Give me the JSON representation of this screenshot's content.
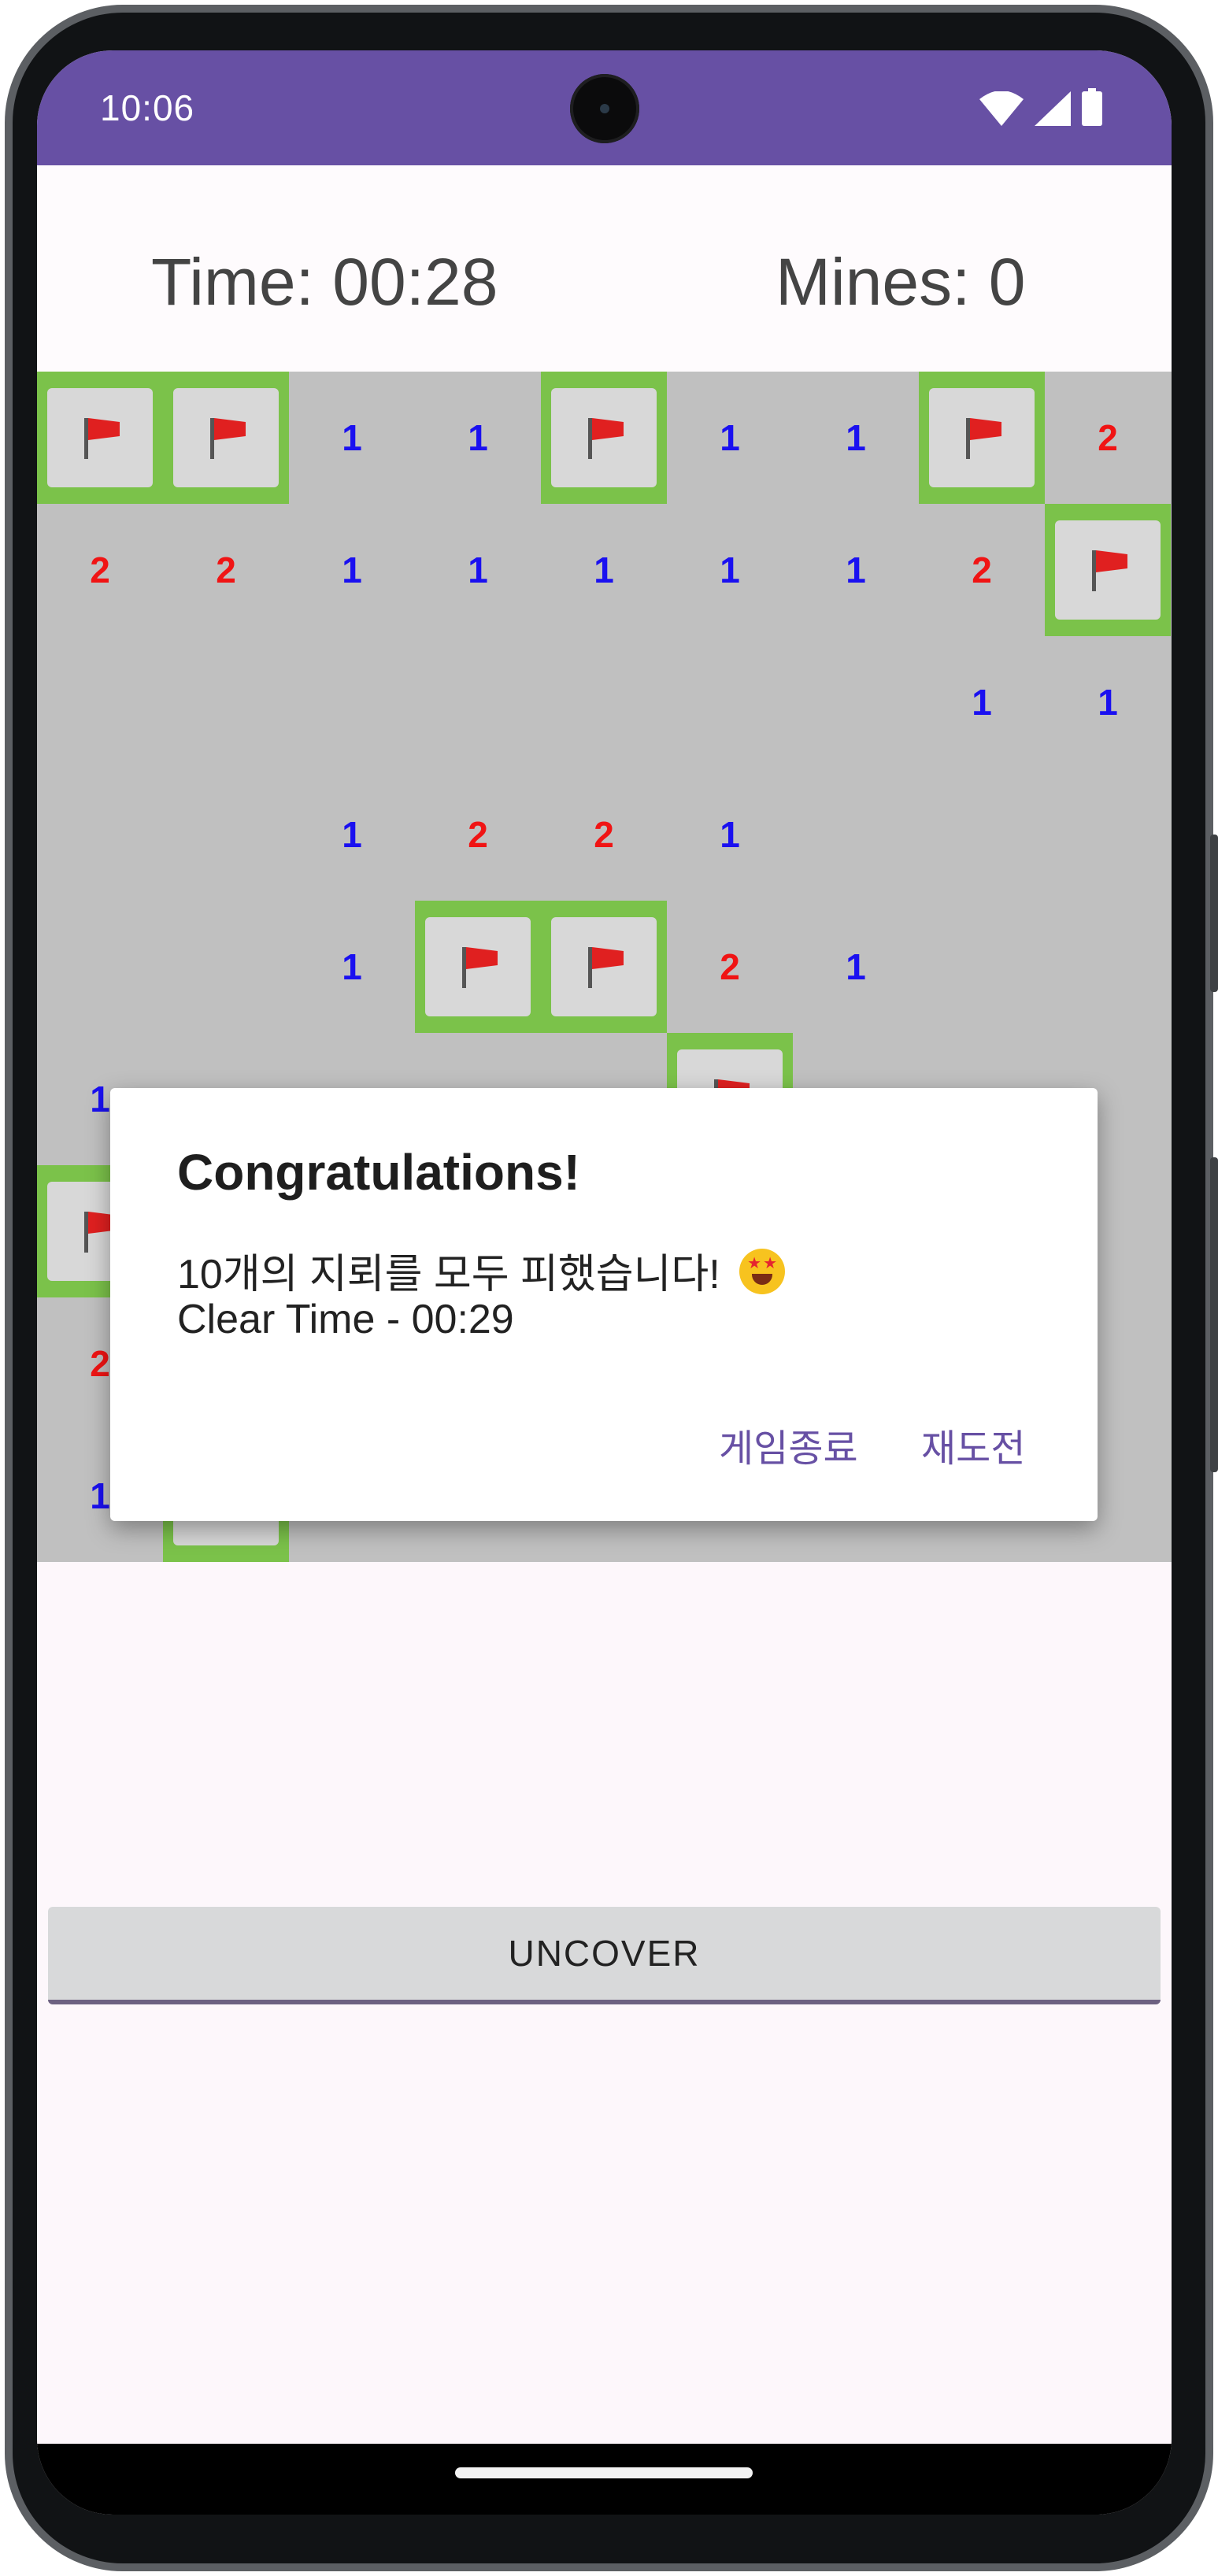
{
  "status_bar": {
    "time": "10:06",
    "icons": [
      "wifi-icon",
      "cellular-signal-icon",
      "battery-icon"
    ],
    "color": "#6750a4"
  },
  "header": {
    "time_label": "Time: 00:28",
    "mines_label": "Mines: 0"
  },
  "board": {
    "columns": 9,
    "visible_rows": [
      [
        "F",
        "F",
        "1",
        "1",
        "F",
        "1",
        "1",
        "F",
        "2"
      ],
      [
        "2",
        "2",
        "1",
        "1",
        "1",
        "1",
        "1",
        "2",
        "F"
      ],
      [
        "",
        "",
        "",
        "",
        "",
        "",
        "",
        "1",
        "1"
      ],
      [
        "",
        "",
        "1",
        "2",
        "2",
        "1",
        "",
        "",
        ""
      ],
      [
        "",
        "",
        "1",
        "F",
        "F",
        "2",
        "1",
        "",
        ""
      ],
      [
        "1",
        "",
        "",
        "",
        "",
        "F",
        "",
        "",
        ""
      ],
      [
        "F",
        "",
        "",
        "",
        "",
        "",
        "",
        "",
        ""
      ],
      [
        "2",
        "",
        "",
        "",
        "",
        "",
        "",
        "",
        ""
      ],
      [
        "1",
        "F",
        "",
        "",
        "",
        "",
        "",
        "",
        ""
      ]
    ],
    "colors": {
      "cell_background": "#c0c0c0",
      "flag_frame": "#7bc24a",
      "number_1": "#1a10f0",
      "number_2": "#f01414"
    }
  },
  "dialog": {
    "title": "Congratulations!",
    "message": "10개의 지뢰를 모두 피했습니다!",
    "emoji": "star-struck-emoji-icon",
    "clear_time": "Clear Time - 00:29",
    "buttons": {
      "quit": "게임종료",
      "retry": "재도전"
    }
  },
  "actions": {
    "uncover_label": "UNCOVER"
  }
}
